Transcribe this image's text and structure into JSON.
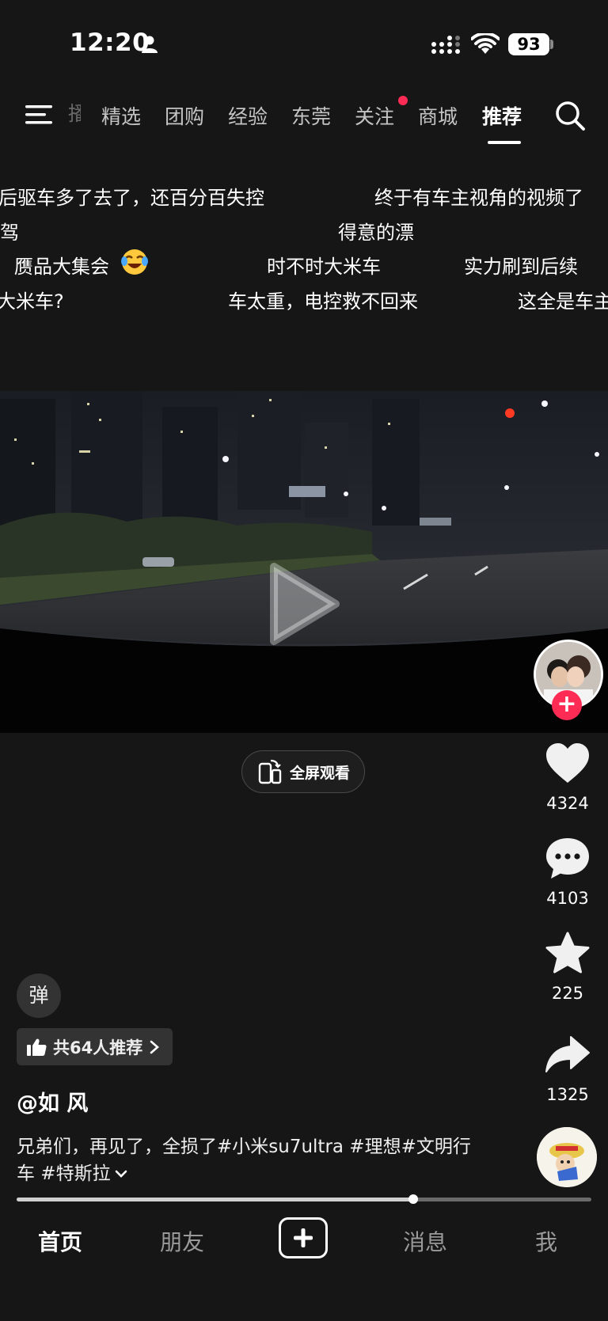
{
  "status_bar": {
    "time": "12:20",
    "battery": "93",
    "icons": [
      "person-icon",
      "signal-icon",
      "wifi-icon",
      "battery-icon"
    ]
  },
  "top_nav": {
    "partial_item": "播",
    "items": [
      "精选",
      "团购",
      "经验",
      "东莞",
      "关注",
      "商城",
      "推荐"
    ],
    "active": "推荐",
    "icons": [
      "menu-icon",
      "search-icon"
    ]
  },
  "danmaku": [
    "后驱车多了去了，还百分百失控",
    "终于有车主视角的视频了",
    "驾",
    "得意的漂",
    "赝品大集会",
    "时不时大米车",
    "实力刷到后续",
    "大米车?",
    "车太重，电控救不回来",
    "这全是车主"
  ],
  "actions": {
    "like_count": "4324",
    "comment_count": "4103",
    "favorite_count": "225",
    "share_count": "1325"
  },
  "fullscreen_label": "全屏观看",
  "danmu_toggle": "弹",
  "recommend": "共64人推荐",
  "author": "@如 风",
  "description": "兄弟们，再见了，全损了#小米su7ultra #理想#文明行车 #特斯拉",
  "progress": 0.69,
  "tabs": [
    "首页",
    "朋友",
    "消息",
    "我"
  ],
  "active_tab": "首页",
  "colors": {
    "accent": "#fe2c55",
    "background": "#161616"
  }
}
